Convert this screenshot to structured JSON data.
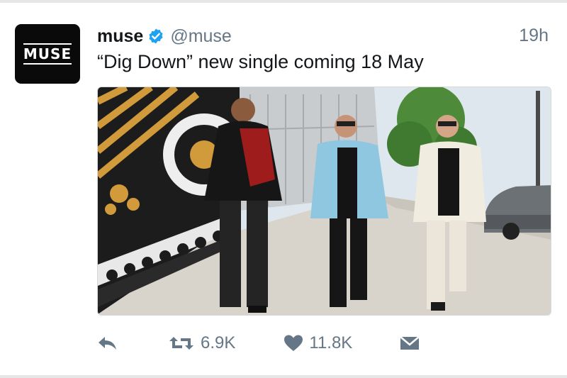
{
  "tweet": {
    "author": {
      "name": "muse",
      "handle": "@muse",
      "avatar_text": "MUSE",
      "verified": true
    },
    "timestamp": "19h",
    "text": "“Dig Down” new single coming 18 May",
    "actions": {
      "retweet_count": "6.9K",
      "like_count": "11.8K"
    }
  },
  "colors": {
    "verified_badge": "#1da1f2",
    "muted_text": "#657786",
    "primary_text": "#14171a"
  },
  "icons": {
    "reply": "reply-arrow-icon",
    "retweet": "retweet-icon",
    "like": "heart-icon",
    "message": "envelope-icon"
  }
}
